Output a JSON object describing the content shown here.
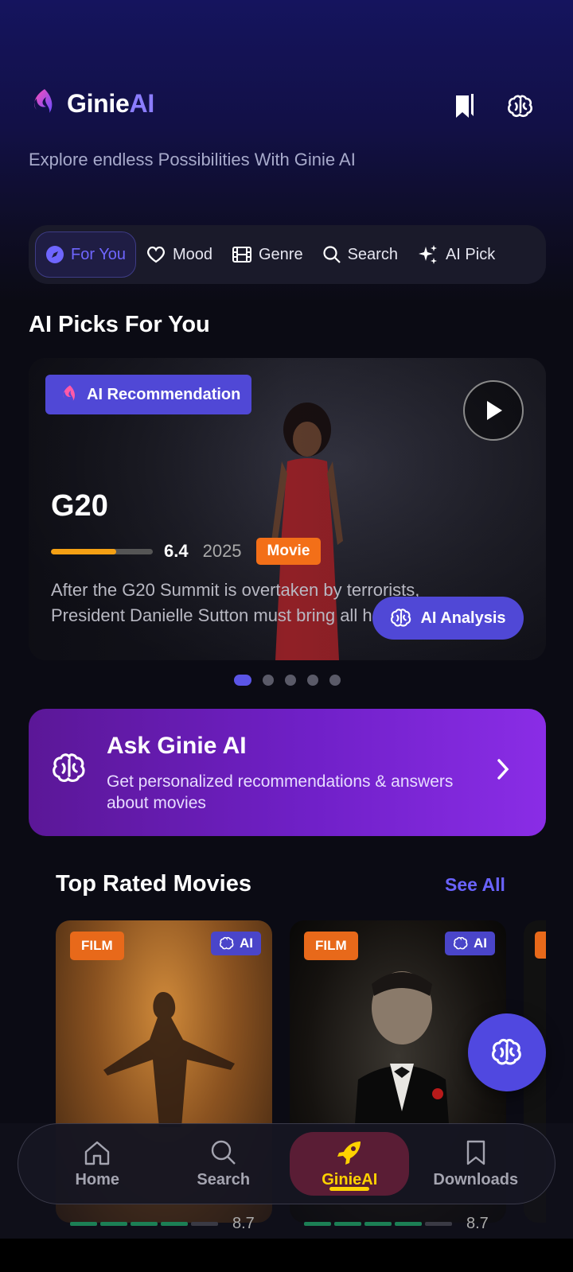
{
  "app": {
    "brand_prefix": "Ginie",
    "brand_suffix": "AI",
    "tagline": "Explore endless Possibilities With Ginie AI"
  },
  "header": {
    "bookmark_icon": "bookmark-icon",
    "brain_icon": "brain-icon"
  },
  "tabs": [
    {
      "label": "For You",
      "icon": "compass-icon",
      "active": true
    },
    {
      "label": "Mood",
      "icon": "heart-icon"
    },
    {
      "label": "Genre",
      "icon": "film-icon"
    },
    {
      "label": "Search",
      "icon": "search-icon"
    },
    {
      "label": "AI Pick",
      "icon": "sparkles-icon"
    }
  ],
  "ai_picks": {
    "section_title": "AI Picks For You",
    "badge": "AI Recommendation",
    "title": "G20",
    "rating": "6.4",
    "rating_fraction": 0.64,
    "year": "2025",
    "type": "Movie",
    "description": "After the G20 Summit is overtaken by terrorists, President Danielle Sutton must bring all her tactical s",
    "analysis_button": "AI Analysis",
    "carousel_count": 5,
    "carousel_active": 0
  },
  "ask": {
    "title": "Ask Ginie AI",
    "subtitle": "Get personalized recommendations & answers about movies"
  },
  "top_rated": {
    "title": "Top Rated Movies",
    "see_all": "See All",
    "movies": [
      {
        "tag": "FILM",
        "ai_tag": "AI",
        "score": "8.7",
        "segments_on": 4
      },
      {
        "tag": "FILM",
        "ai_tag": "AI",
        "score": "8.7",
        "segments_on": 4
      }
    ]
  },
  "nav": [
    {
      "label": "Home",
      "icon": "home-icon"
    },
    {
      "label": "Search",
      "icon": "search-icon"
    },
    {
      "label": "GinieAI",
      "icon": "rocket-icon",
      "active": true
    },
    {
      "label": "Downloads",
      "icon": "bookmark-icon"
    }
  ],
  "colors": {
    "accent": "#5b55e6",
    "brand_ai": "#8b7dff",
    "active_nav": "#ffd200",
    "orange": "#f36f18"
  }
}
